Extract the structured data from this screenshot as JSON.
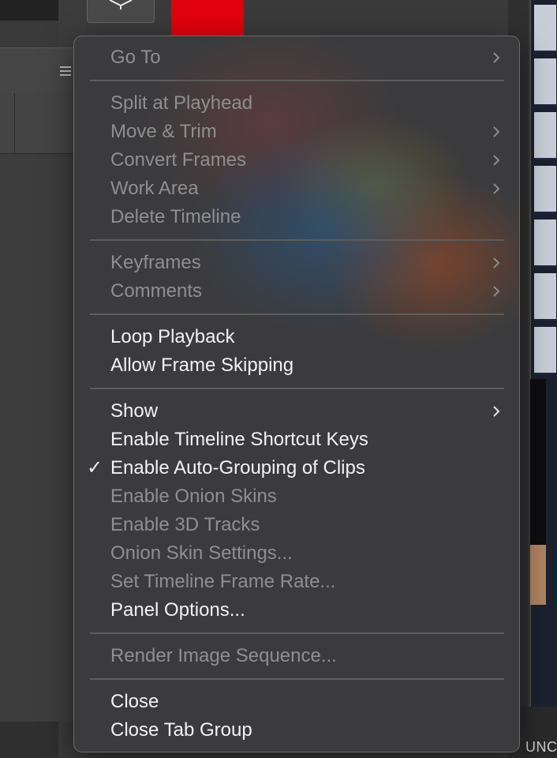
{
  "menu": {
    "groups": [
      {
        "items": [
          {
            "label": "Go To",
            "enabled": false,
            "submenu": true
          }
        ]
      },
      {
        "items": [
          {
            "label": "Split at Playhead",
            "enabled": false,
            "submenu": false
          },
          {
            "label": "Move & Trim",
            "enabled": false,
            "submenu": true
          },
          {
            "label": "Convert Frames",
            "enabled": false,
            "submenu": true
          },
          {
            "label": "Work Area",
            "enabled": false,
            "submenu": true
          },
          {
            "label": "Delete Timeline",
            "enabled": false,
            "submenu": false
          }
        ]
      },
      {
        "items": [
          {
            "label": "Keyframes",
            "enabled": false,
            "submenu": true
          },
          {
            "label": "Comments",
            "enabled": false,
            "submenu": true
          }
        ]
      },
      {
        "items": [
          {
            "label": "Loop Playback",
            "enabled": true,
            "submenu": false
          },
          {
            "label": "Allow Frame Skipping",
            "enabled": true,
            "submenu": false
          }
        ]
      },
      {
        "items": [
          {
            "label": "Show",
            "enabled": true,
            "submenu": true
          },
          {
            "label": "Enable Timeline Shortcut Keys",
            "enabled": true,
            "submenu": false
          },
          {
            "label": "Enable Auto-Grouping of Clips",
            "enabled": true,
            "submenu": false,
            "checked": true,
            "check_glyph": "✓"
          },
          {
            "label": "Enable Onion Skins",
            "enabled": false,
            "submenu": false
          },
          {
            "label": "Enable 3D Tracks",
            "enabled": false,
            "submenu": false
          },
          {
            "label": "Onion Skin Settings...",
            "enabled": false,
            "submenu": false
          },
          {
            "label": "Set Timeline Frame Rate...",
            "enabled": false,
            "submenu": false
          },
          {
            "label": "Panel Options...",
            "enabled": true,
            "submenu": false
          }
        ]
      },
      {
        "items": [
          {
            "label": "Render Image Sequence...",
            "enabled": false,
            "submenu": false
          }
        ]
      },
      {
        "items": [
          {
            "label": "Close",
            "enabled": true,
            "submenu": false
          },
          {
            "label": "Close Tab Group",
            "enabled": true,
            "submenu": false
          }
        ]
      }
    ]
  },
  "background": {
    "right_edge_text": "UNC",
    "accent_color": "#e1000e"
  }
}
